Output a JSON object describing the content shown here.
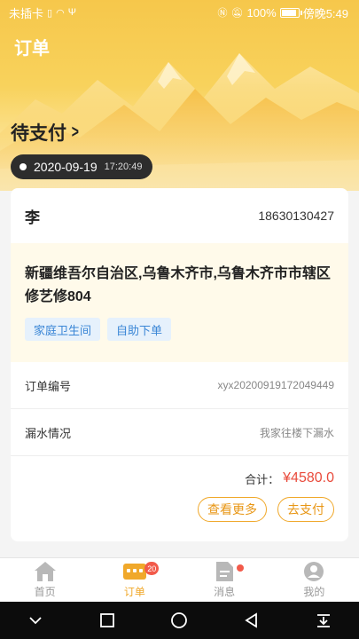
{
  "statusbar": {
    "carrier": "未插卡",
    "battery": "100%",
    "time": "傍晚5:49"
  },
  "header": {
    "title": "订单"
  },
  "order_status": {
    "label": "待支付"
  },
  "order": {
    "date": "2020-09-19",
    "time": "17:20:49",
    "customer_name": "李",
    "phone": "18630130427",
    "address": "新疆维吾尔自治区,乌鲁木齐市,乌鲁木齐市市辖区修艺修804",
    "tags": [
      "家庭卫生间",
      "自助下单"
    ],
    "fields": [
      {
        "label": "订单编号",
        "value": "xyx20200919172049449"
      },
      {
        "label": "漏水情况",
        "value": "我家往楼下漏水"
      }
    ],
    "total_label": "合计：",
    "total_value": "¥4580.0",
    "more_button": "查看更多",
    "pay_button": "去支付"
  },
  "tabbar": {
    "items": [
      {
        "label": "首页",
        "icon": "home-icon"
      },
      {
        "label": "订单",
        "icon": "orders-icon",
        "badge": "20"
      },
      {
        "label": "消息",
        "icon": "message-icon"
      },
      {
        "label": "我的",
        "icon": "profile-icon"
      }
    ]
  },
  "colors": {
    "accent": "#f0a82a",
    "price": "#e94b3c",
    "tag_text": "#3a86d6",
    "header_bg": "#f6c74b"
  }
}
